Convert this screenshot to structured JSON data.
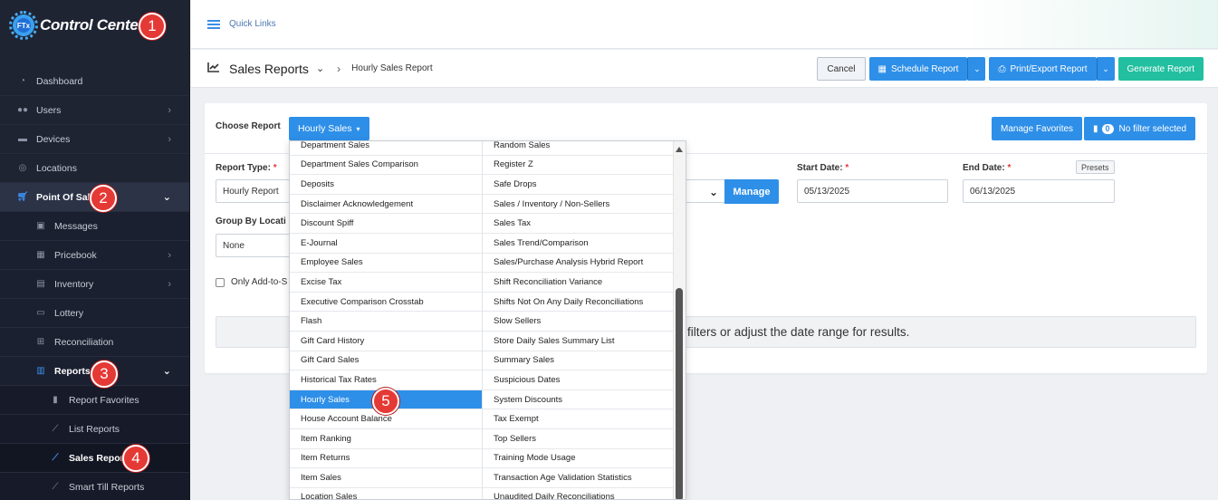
{
  "app": {
    "title": "Control Center",
    "logo_text": "FTx"
  },
  "sidebar": {
    "items": [
      {
        "label": "Dashboard",
        "icon": "dashboard-icon"
      },
      {
        "label": "Users",
        "icon": "users-icon"
      },
      {
        "label": "Devices",
        "icon": "devices-icon"
      },
      {
        "label": "Locations",
        "icon": "location-pin-icon"
      },
      {
        "label": "Point Of Sale",
        "icon": "cart-icon"
      },
      {
        "label": "Messages",
        "icon": "message-icon"
      },
      {
        "label": "Pricebook",
        "icon": "calculator-icon"
      },
      {
        "label": "Inventory",
        "icon": "inventory-icon"
      },
      {
        "label": "Lottery",
        "icon": "ticket-icon"
      },
      {
        "label": "Reconciliation",
        "icon": "grid-icon"
      },
      {
        "label": "Reports",
        "icon": "bar-chart-icon"
      },
      {
        "label": "Report Favorites",
        "icon": "bookmark-icon"
      },
      {
        "label": "List Reports",
        "icon": "line-chart-icon"
      },
      {
        "label": "Sales Reports",
        "icon": "line-chart-icon"
      },
      {
        "label": "Smart Till Reports",
        "icon": "line-chart-icon"
      }
    ]
  },
  "steps": [
    "1",
    "2",
    "3",
    "4",
    "5"
  ],
  "topbar": {
    "quick_links": "Quick Links"
  },
  "header": {
    "title": "Sales Reports",
    "breadcrumb": "Hourly Sales Report",
    "cancel": "Cancel",
    "schedule": "Schedule Report",
    "print": "Print/Export Report",
    "generate": "Generate Report"
  },
  "form": {
    "choose_label": "Choose Report",
    "selected_report": "Hourly Sales",
    "manage_favorites": "Manage Favorites",
    "filter_count": "0",
    "filter_text": "No filter selected",
    "report_type_label": "Report Type:",
    "report_type_value": "Hourly Report",
    "group_by_label": "Group By Locati",
    "group_by_value": "None",
    "manage": "Manage",
    "start_date_label": "Start Date:",
    "start_date": "05/13/2025",
    "end_date_label": "End Date:",
    "end_date": "06/13/2025",
    "presets": "Presets",
    "only_add_label": "Only Add-to-S",
    "required_mark": "*",
    "notice": "filters or adjust the date range for results."
  },
  "dropdown": {
    "left": [
      "Department Sales",
      "Department Sales Comparison",
      "Deposits",
      "Disclaimer Acknowledgement",
      "Discount Spiff",
      "E-Journal",
      "Employee Sales",
      "Excise Tax",
      "Executive Comparison Crosstab",
      "Flash",
      "Gift Card History",
      "Gift Card Sales",
      "Historical Tax Rates",
      "Hourly Sales",
      "House Account Balance",
      "Item Ranking",
      "Item Returns",
      "Item Sales",
      "Location Sales"
    ],
    "right": [
      "Random Sales",
      "Register Z",
      "Safe Drops",
      "Sales / Inventory / Non-Sellers",
      "Sales Tax",
      "Sales Trend/Comparison",
      "Sales/Purchase Analysis Hybrid Report",
      "Shift Reconciliation Variance",
      "Shifts Not On Any Daily Reconciliations",
      "Slow Sellers",
      "Store Daily Sales Summary List",
      "Summary Sales",
      "Suspicious Dates",
      "System Discounts",
      "Tax Exempt",
      "Top Sellers",
      "Training Mode Usage",
      "Transaction Age Validation Statistics",
      "Unaudited Daily Reconciliations"
    ],
    "selected_index": 13
  }
}
